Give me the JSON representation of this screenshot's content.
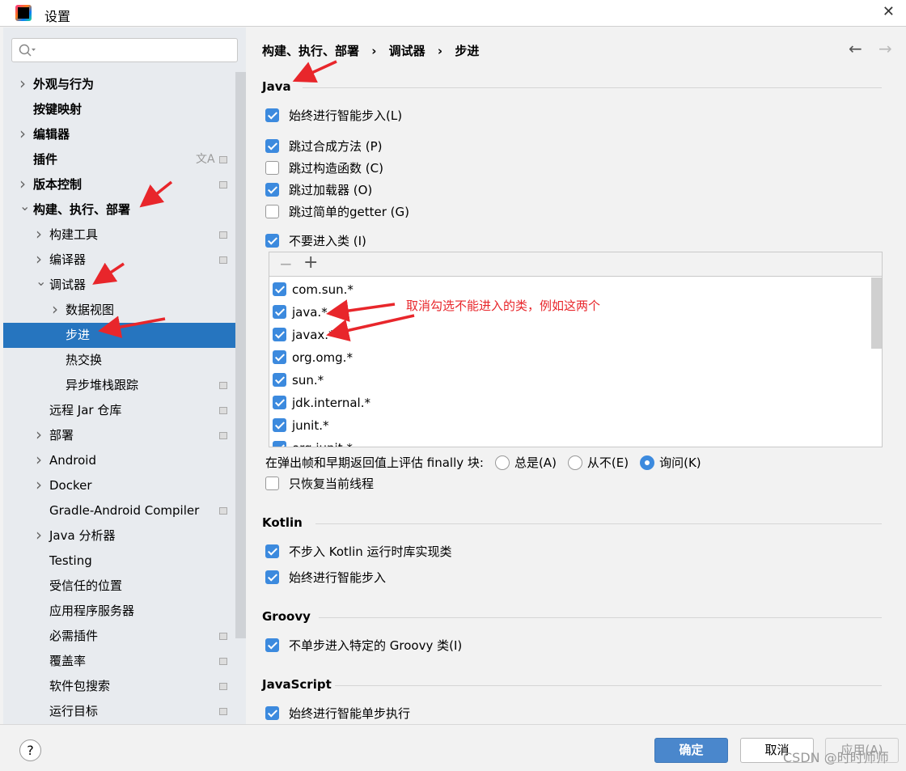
{
  "window": {
    "title": "设置",
    "close_icon": "close-icon"
  },
  "search": {
    "placeholder": ""
  },
  "sidebar": {
    "items": [
      {
        "label": "外观与行为",
        "level": 0,
        "chevron": "right",
        "bold": true
      },
      {
        "label": "按键映射",
        "level": 0,
        "bold": true
      },
      {
        "label": "编辑器",
        "level": 0,
        "chevron": "right",
        "bold": true
      },
      {
        "label": "插件",
        "level": 0,
        "bold": true,
        "translate": true,
        "page": true
      },
      {
        "label": "版本控制",
        "level": 0,
        "chevron": "right",
        "bold": true,
        "page": true
      },
      {
        "label": "构建、执行、部署",
        "level": 0,
        "chevron": "down",
        "bold": true
      },
      {
        "label": "构建工具",
        "level": 1,
        "chevron": "right",
        "page": true
      },
      {
        "label": "编译器",
        "level": 1,
        "chevron": "right",
        "page": true
      },
      {
        "label": "调试器",
        "level": 1,
        "chevron": "down"
      },
      {
        "label": "数据视图",
        "level": 2,
        "chevron": "right"
      },
      {
        "label": "步进",
        "level": 2,
        "selected": true
      },
      {
        "label": "热交换",
        "level": 2
      },
      {
        "label": "异步堆栈跟踪",
        "level": 2,
        "page": true
      },
      {
        "label": "远程 Jar 仓库",
        "level": 1,
        "page": true
      },
      {
        "label": "部署",
        "level": 1,
        "chevron": "right",
        "page": true
      },
      {
        "label": "Android",
        "level": 1,
        "chevron": "right"
      },
      {
        "label": "Docker",
        "level": 1,
        "chevron": "right"
      },
      {
        "label": "Gradle-Android Compiler",
        "level": 1,
        "page": true
      },
      {
        "label": "Java 分析器",
        "level": 1,
        "chevron": "right"
      },
      {
        "label": "Testing",
        "level": 1
      },
      {
        "label": "受信任的位置",
        "level": 1
      },
      {
        "label": "应用程序服务器",
        "level": 1
      },
      {
        "label": "必需插件",
        "level": 1,
        "page": true
      },
      {
        "label": "覆盖率",
        "level": 1,
        "page": true
      },
      {
        "label": "软件包搜索",
        "level": 1,
        "page": true
      },
      {
        "label": "运行目标",
        "level": 1,
        "page": true
      }
    ]
  },
  "breadcrumb": [
    "构建、执行、部署",
    "调试器",
    "步进"
  ],
  "breadcrumb_sep": "›",
  "nav": {
    "back": "←",
    "forward": "→"
  },
  "sections": {
    "java": {
      "title": "Java",
      "options": [
        {
          "label": "始终进行智能步入(L)",
          "checked": true
        },
        {
          "label": "跳过合成方法 (P)",
          "checked": true
        },
        {
          "label": "跳过构造函数 (C)",
          "checked": false
        },
        {
          "label": "跳过加载器 (O)",
          "checked": true
        },
        {
          "label": "跳过简单的getter (G)",
          "checked": false
        },
        {
          "label": "不要进入类 (I)",
          "checked": true
        }
      ],
      "class_list": [
        {
          "label": "com.sun.*",
          "checked": true
        },
        {
          "label": "java.*",
          "checked": true
        },
        {
          "label": "javax.*",
          "checked": true
        },
        {
          "label": "org.omg.*",
          "checked": true
        },
        {
          "label": "sun.*",
          "checked": true
        },
        {
          "label": "jdk.internal.*",
          "checked": true
        },
        {
          "label": "junit.*",
          "checked": true
        },
        {
          "label": "org.junit.*",
          "checked": true
        }
      ],
      "list_tools": {
        "remove": "−",
        "add": "+"
      },
      "finally_label": "在弹出帧和早期返回值上评估 finally 块:",
      "finally_options": [
        {
          "label": "总是(A)",
          "selected": false
        },
        {
          "label": "从不(E)",
          "selected": false
        },
        {
          "label": "询问(K)",
          "selected": true
        }
      ],
      "resume_current": {
        "label": "只恢复当前线程",
        "checked": false
      }
    },
    "kotlin": {
      "title": "Kotlin",
      "options": [
        {
          "label": "不步入 Kotlin 运行时库实现类",
          "checked": true
        },
        {
          "label": "始终进行智能步入",
          "checked": true
        }
      ]
    },
    "groovy": {
      "title": "Groovy",
      "options": [
        {
          "label": "不单步进入特定的 Groovy 类(I)",
          "checked": true
        }
      ]
    },
    "javascript": {
      "title": "JavaScript",
      "options": [
        {
          "label": "始终进行智能单步执行",
          "checked": true
        }
      ]
    }
  },
  "annotation": {
    "text": "取消勾选不能进入的类，例如这两个",
    "color": "#e8262b"
  },
  "footer": {
    "help": "?",
    "ok": "确定",
    "cancel": "取消",
    "apply": "应用(A)"
  },
  "watermark": "CSDN @时时师师",
  "colors": {
    "accent": "#2675bf",
    "checkbox": "#3c8ade",
    "primary_button": "#4a87cc"
  }
}
